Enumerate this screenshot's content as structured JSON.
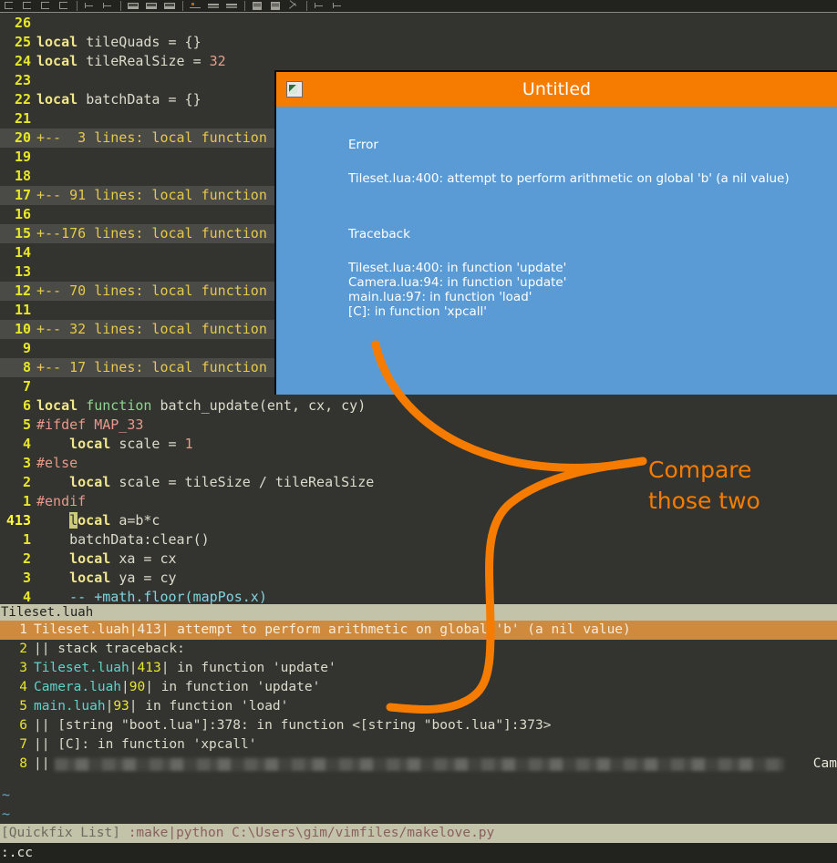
{
  "toolbar": {
    "icons": [
      "new-file-icon",
      "open-file-icon",
      "save-file-icon",
      "save-all-icon",
      "undo-icon",
      "redo-icon",
      "cut-icon",
      "copy-icon",
      "paste-icon",
      "find-icon",
      "replace-icon",
      "print-icon",
      "make-icon",
      "build-icon",
      "quickfix-icon",
      "help-icon",
      "tag-icon",
      "exit-icon"
    ]
  },
  "editor": {
    "lines": [
      {
        "num": "26",
        "fold": false,
        "tokens": []
      },
      {
        "num": "25",
        "fold": false,
        "tokens": [
          {
            "t": "local ",
            "c": "kw"
          },
          {
            "t": "tileQuads = {}",
            "c": "code"
          }
        ]
      },
      {
        "num": "24",
        "fold": false,
        "tokens": [
          {
            "t": "local ",
            "c": "kw"
          },
          {
            "t": "tileRealSize = ",
            "c": "code"
          },
          {
            "t": "32",
            "c": "num-lit"
          }
        ]
      },
      {
        "num": "23",
        "fold": false,
        "tokens": []
      },
      {
        "num": "22",
        "fold": false,
        "tokens": [
          {
            "t": "local ",
            "c": "kw"
          },
          {
            "t": "batchData = {}",
            "c": "code"
          }
        ]
      },
      {
        "num": "21",
        "fold": false,
        "tokens": []
      },
      {
        "num": "20",
        "fold": true,
        "tokens": [
          {
            "t": "+--  3 lines: local function ",
            "c": "fold-txt"
          }
        ]
      },
      {
        "num": "19",
        "fold": false,
        "tokens": []
      },
      {
        "num": "18",
        "fold": false,
        "tokens": []
      },
      {
        "num": "17",
        "fold": true,
        "tokens": [
          {
            "t": "+-- 91 lines: local function ",
            "c": "fold-txt"
          }
        ]
      },
      {
        "num": "16",
        "fold": false,
        "tokens": []
      },
      {
        "num": "15",
        "fold": true,
        "tokens": [
          {
            "t": "+--176 lines: local function ",
            "c": "fold-txt"
          }
        ]
      },
      {
        "num": "14",
        "fold": false,
        "tokens": []
      },
      {
        "num": "13",
        "fold": false,
        "tokens": []
      },
      {
        "num": "12",
        "fold": true,
        "tokens": [
          {
            "t": "+-- 70 lines: local function ",
            "c": "fold-txt"
          }
        ]
      },
      {
        "num": "11",
        "fold": false,
        "tokens": []
      },
      {
        "num": "10",
        "fold": true,
        "tokens": [
          {
            "t": "+-- 32 lines: local function ",
            "c": "fold-txt"
          }
        ]
      },
      {
        "num": "9",
        "fold": false,
        "tokens": []
      },
      {
        "num": "8",
        "fold": true,
        "tokens": [
          {
            "t": "+-- 17 lines: local function ",
            "c": "fold-txt"
          }
        ]
      },
      {
        "num": "7",
        "fold": false,
        "tokens": []
      },
      {
        "num": "6",
        "fold": false,
        "tokens": [
          {
            "t": "local ",
            "c": "kw"
          },
          {
            "t": "function ",
            "c": "kw2"
          },
          {
            "t": "batch_update(ent, cx, cy)",
            "c": "code"
          }
        ]
      },
      {
        "num": "5",
        "fold": false,
        "tokens": [
          {
            "t": "#ifdef MAP_33",
            "c": "pre"
          }
        ]
      },
      {
        "num": "4",
        "fold": false,
        "tokens": [
          {
            "t": "    ",
            "c": "code"
          },
          {
            "t": "local ",
            "c": "kw"
          },
          {
            "t": "scale = ",
            "c": "code"
          },
          {
            "t": "1",
            "c": "num-lit"
          }
        ]
      },
      {
        "num": "3",
        "fold": false,
        "tokens": [
          {
            "t": "#else",
            "c": "pre"
          }
        ]
      },
      {
        "num": "2",
        "fold": false,
        "tokens": [
          {
            "t": "    ",
            "c": "code"
          },
          {
            "t": "local ",
            "c": "kw"
          },
          {
            "t": "scale = tileSize / tileRealSize",
            "c": "code"
          }
        ]
      },
      {
        "num": "1",
        "fold": false,
        "tokens": [
          {
            "t": "#endif",
            "c": "pre"
          }
        ]
      },
      {
        "num": "413",
        "fold": false,
        "current": true,
        "tokens": [
          {
            "t": "    ",
            "c": "code"
          },
          {
            "t": "l",
            "c": "cursor"
          },
          {
            "t": "ocal ",
            "c": "kw"
          },
          {
            "t": "a=b*c",
            "c": "code"
          }
        ]
      },
      {
        "num": "1",
        "fold": false,
        "tokens": [
          {
            "t": "    batchData:clear()",
            "c": "code"
          }
        ]
      },
      {
        "num": "2",
        "fold": false,
        "tokens": [
          {
            "t": "    ",
            "c": "code"
          },
          {
            "t": "local ",
            "c": "kw"
          },
          {
            "t": "xa = cx",
            "c": "code"
          }
        ]
      },
      {
        "num": "3",
        "fold": false,
        "tokens": [
          {
            "t": "    ",
            "c": "code"
          },
          {
            "t": "local ",
            "c": "kw"
          },
          {
            "t": "ya = cy",
            "c": "code"
          }
        ]
      },
      {
        "num": "4",
        "fold": false,
        "tokens": [
          {
            "t": "    ",
            "c": "code"
          },
          {
            "t": "-- +math.floor(mapPos.x)",
            "c": "cmt"
          }
        ]
      }
    ]
  },
  "dialog": {
    "title": "Untitled",
    "error_heading": "Error",
    "error_message": "Tileset.lua:400: attempt to perform arithmetic on global 'b' (a nil value)",
    "traceback_heading": "Traceback",
    "traceback_lines": [
      "Tileset.lua:400: in function 'update'",
      "Camera.lua:94: in function 'update'",
      "main.lua:97: in function 'load'",
      "[C]: in function 'xpcall'"
    ]
  },
  "quickfix": {
    "buffer_name": "Tileset.luah",
    "rows": [
      {
        "num": "1",
        "selected": true,
        "file": "Tileset.luah",
        "lnum": "413",
        "text": "attempt to perform arithmetic on global 'b' (a nil value)"
      },
      {
        "num": "2",
        "selected": false,
        "file": "",
        "lnum": "",
        "text": "|| stack traceback:"
      },
      {
        "num": "3",
        "selected": false,
        "file": "Tileset.luah",
        "lnum": "413",
        "text": "in function 'update'"
      },
      {
        "num": "4",
        "selected": false,
        "file": "Camera.luah",
        "lnum": "90",
        "text": "in function 'update'"
      },
      {
        "num": "5",
        "selected": false,
        "file": "main.luah",
        "lnum": "93",
        "text": "in function 'load'"
      },
      {
        "num": "6",
        "selected": false,
        "file": "",
        "lnum": "",
        "text": "|| [string \"boot.lua\"]:378: in function <[string \"boot.lua\"]:373>"
      },
      {
        "num": "7",
        "selected": false,
        "file": "",
        "lnum": "",
        "text": "|| [C]: in function 'xpcall'"
      },
      {
        "num": "8",
        "selected": false,
        "file": "",
        "lnum": "",
        "text": "||",
        "redacted": true,
        "trailing": "Cam"
      }
    ],
    "empty_markers": [
      "~",
      "~"
    ]
  },
  "statusline": {
    "buffer_label": "[Quickfix List]",
    "command": ":make|python C:\\Users\\gim/vimfiles/makelove.py"
  },
  "commandline": ":.cc",
  "annotation": {
    "line1": "Compare",
    "line2": "those two",
    "color": "#f57c00"
  },
  "colors": {
    "editor_bg": "#333330",
    "dialog_title_bg": "#f57c00",
    "dialog_body_bg": "#5b9bd5",
    "fold_bg": "#4a4a46",
    "status_bg": "#c2c3a8",
    "qf_selected_bg": "#d08a3e",
    "line_number": "#e7e72a",
    "accent_orange": "#f57c00"
  }
}
